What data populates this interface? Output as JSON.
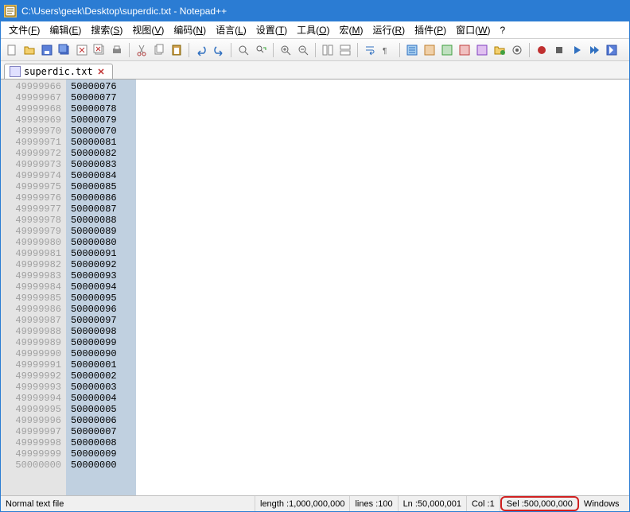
{
  "titlebar": {
    "title": "C:\\Users\\geek\\Desktop\\superdic.txt - Notepad++"
  },
  "menu": {
    "file": {
      "label": "文件(",
      "hotkey": "F",
      "suffix": ")"
    },
    "edit": {
      "label": "编辑(",
      "hotkey": "E",
      "suffix": ")"
    },
    "search": {
      "label": "搜索(",
      "hotkey": "S",
      "suffix": ")"
    },
    "view": {
      "label": "视图(",
      "hotkey": "V",
      "suffix": ")"
    },
    "encoding": {
      "label": "编码(",
      "hotkey": "N",
      "suffix": ")"
    },
    "language": {
      "label": "语言(",
      "hotkey": "L",
      "suffix": ")"
    },
    "settings": {
      "label": "设置(",
      "hotkey": "T",
      "suffix": ")"
    },
    "tools": {
      "label": "工具(",
      "hotkey": "O",
      "suffix": ")"
    },
    "macro": {
      "label": "宏(",
      "hotkey": "M",
      "suffix": ")"
    },
    "run": {
      "label": "运行(",
      "hotkey": "R",
      "suffix": ")"
    },
    "plugins": {
      "label": "插件(",
      "hotkey": "P",
      "suffix": ")"
    },
    "window": {
      "label": "窗口(",
      "hotkey": "W",
      "suffix": ")"
    },
    "help": {
      "label": "?"
    }
  },
  "tab": {
    "name": "superdic.txt"
  },
  "editor": {
    "lineNumbers": [
      "49999966",
      "49999967",
      "49999968",
      "49999969",
      "49999970",
      "49999971",
      "49999972",
      "49999973",
      "49999974",
      "49999975",
      "49999976",
      "49999977",
      "49999978",
      "49999979",
      "49999980",
      "49999981",
      "49999982",
      "49999983",
      "49999984",
      "49999985",
      "49999986",
      "49999987",
      "49999988",
      "49999989",
      "49999990",
      "49999991",
      "49999992",
      "49999993",
      "49999994",
      "49999995",
      "49999996",
      "49999997",
      "49999998",
      "49999999",
      "50000000"
    ],
    "contentLines": [
      "50000076",
      "50000077",
      "50000078",
      "50000079",
      "50000070",
      "50000081",
      "50000082",
      "50000083",
      "50000084",
      "50000085",
      "50000086",
      "50000087",
      "50000088",
      "50000089",
      "50000080",
      "50000091",
      "50000092",
      "50000093",
      "50000094",
      "50000095",
      "50000096",
      "50000097",
      "50000098",
      "50000099",
      "50000090",
      "50000001",
      "50000002",
      "50000003",
      "50000004",
      "50000005",
      "50000006",
      "50000007",
      "50000008",
      "50000009",
      "50000000"
    ]
  },
  "status": {
    "fileType": "Normal text file",
    "lengthLabel": "length : ",
    "length": "1,000,000,000",
    "linesLabel": "lines : ",
    "lines": "100",
    "lnLabel": "Ln : ",
    "ln": "50,000,001",
    "colLabel": "Col : ",
    "col": "1",
    "selLabel": "Sel : ",
    "sel": "500,000,000",
    "eol": "Windows"
  }
}
